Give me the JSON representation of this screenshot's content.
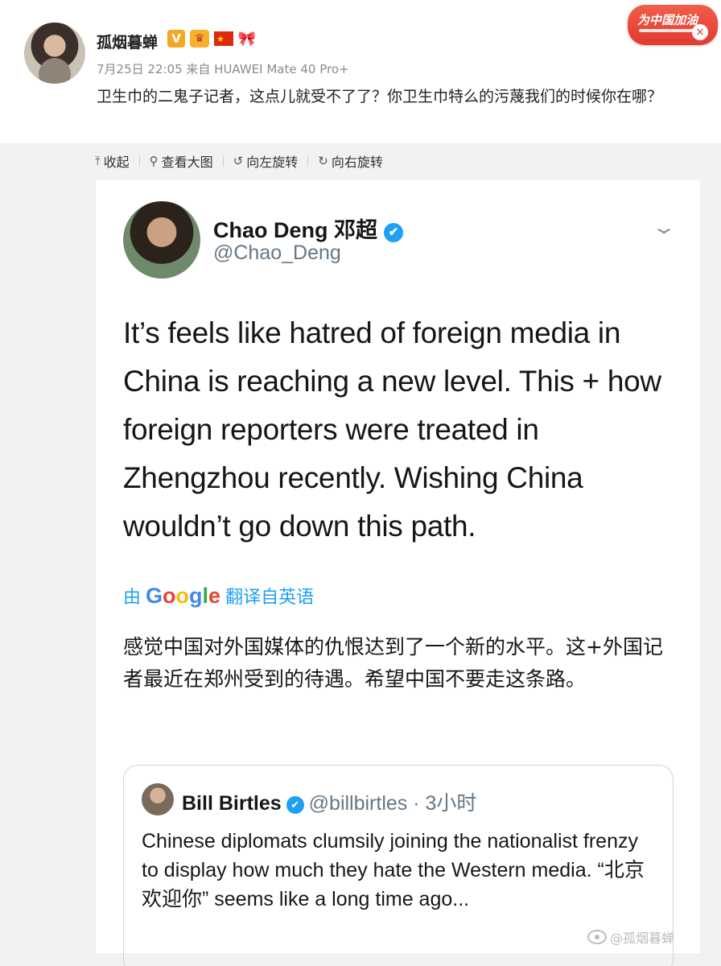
{
  "post": {
    "username": "孤烟暮蝉",
    "badges": [
      "V",
      "♛",
      "★",
      "🎀"
    ],
    "meta": "7月25日 22:05 来自 HUAWEI Mate 40 Pro+",
    "text": "卫生巾的二鬼子记者，这点儿就受不了了？你卫生巾特么的污蔑我们的时候你在哪？",
    "cheer_badge": "为中国加油",
    "cheer_close": "×"
  },
  "toolbar": {
    "collapse": {
      "icon": "⤒",
      "label": "收起"
    },
    "view_large": {
      "icon": "⚲",
      "label": "查看大图"
    },
    "rotate_left": {
      "icon": "↺",
      "label": "向左旋转"
    },
    "rotate_right": {
      "icon": "↻",
      "label": "向右旋转"
    }
  },
  "tweet": {
    "name": "Chao Deng 邓超",
    "verified_icon": "✔",
    "handle": "@Chao_Deng",
    "chevron": "⌄",
    "body": "It’s feels like hatred of foreign media in China is reaching a new level. This + how foreign reporters were treated in Zhengzhou recently. Wishing China wouldn’t go down this path.",
    "translate_prefix": "由",
    "google": [
      "G",
      "o",
      "o",
      "g",
      "l",
      "e"
    ],
    "translate_suffix": "翻译自英语",
    "translation": "感觉中国对外国媒体的仇恨达到了一个新的水平。这+外国记者最近在郑州受到的待遇。希望中国不要走这条路。"
  },
  "quote": {
    "name": "Bill Birtles",
    "handle_time": "@billbirtles · 3小时",
    "body": "Chinese diplomats clumsily joining the nationalist frenzy to display how much they hate the Western media. “北京欢迎你” seems like a long time ago..."
  },
  "watermark": "@孤烟暮蝉",
  "colors": {
    "twitter_blue": "#1da1f2",
    "weibo_orange": "#f5a623",
    "cheer_red": "#e23a2e",
    "meta_gray": "#8a8a8a"
  }
}
